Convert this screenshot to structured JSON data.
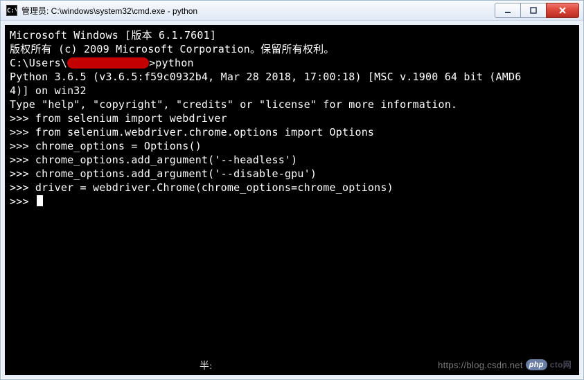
{
  "titlebar": {
    "icon_label": "C:\\",
    "title": "管理员: C:\\windows\\system32\\cmd.exe - python"
  },
  "window_controls": {
    "minimize": "minimize",
    "maximize": "maximize",
    "close": "close"
  },
  "terminal": {
    "lines": [
      "Microsoft Windows [版本 6.1.7601]",
      "版权所有 (c) 2009 Microsoft Corporation。保留所有权利。",
      "",
      "PROMPT_LINE",
      "Python 3.6.5 (v3.6.5:f59c0932b4, Mar 28 2018, 17:00:18) [MSC v.1900 64 bit (AMD6",
      "4)] on win32",
      "Type \"help\", \"copyright\", \"credits\" or \"license\" for more information.",
      ">>> from selenium import webdriver",
      ">>> from selenium.webdriver.chrome.options import Options",
      ">>> chrome_options = Options()",
      ">>> chrome_options.add_argument('--headless')",
      ">>> chrome_options.add_argument('--disable-gpu')",
      ">>> driver = webdriver.Chrome(chrome_options=chrome_options)",
      ">>> "
    ],
    "prompt_prefix": "C:\\Users\\",
    "prompt_suffix": ">python"
  },
  "footer": {
    "han_text": "半:",
    "watermark_url": "https://blog.csdn.net",
    "watermark_badge": "php",
    "watermark_suffix": "cto网"
  }
}
